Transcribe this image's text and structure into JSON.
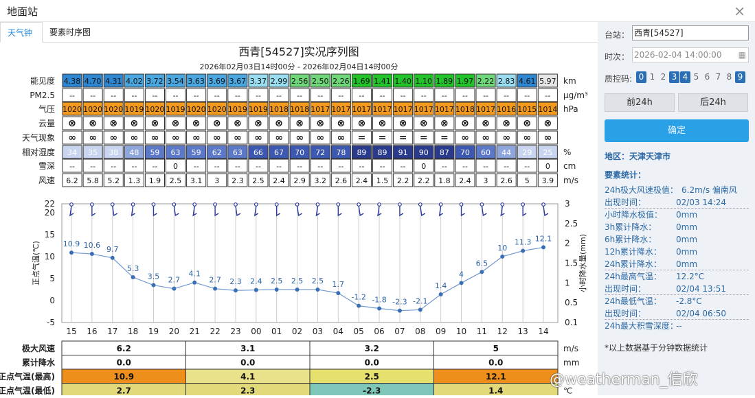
{
  "window": {
    "title": "地面站",
    "close": "×"
  },
  "tabs": [
    {
      "label": "天气钟",
      "active": true
    },
    {
      "label": "要素时序图",
      "active": false
    }
  ],
  "chart_title": "西青[54527]实况序列图",
  "time_range": "2026年02月03日14时00分 - 2026年02月04日14时00分",
  "rows": [
    {
      "label": "能见度",
      "unit": "km",
      "values": [
        "4.38",
        "4.70",
        "4.31",
        "4.02",
        "3.72",
        "3.54",
        "3.63",
        "3.69",
        "3.67",
        "3.37",
        "2.99",
        "2.56",
        "2.50",
        "2.26",
        "1.69",
        "1.41",
        "1.40",
        "1.10",
        "1.89",
        "1.97",
        "2.22",
        "2.83",
        "4.61",
        "5.97"
      ]
    },
    {
      "label": "PM2.5",
      "unit": "μg/m³",
      "values": [
        "--",
        "--",
        "--",
        "--",
        "--",
        "--",
        "--",
        "--",
        "--",
        "--",
        "--",
        "--",
        "--",
        "--",
        "--",
        "--",
        "--",
        "--",
        "--",
        "--",
        "--",
        "--",
        "--",
        "--"
      ]
    },
    {
      "label": "气压",
      "unit": "hPa",
      "values": [
        "1020",
        "1020",
        "1020",
        "1019",
        "1020",
        "1019",
        "1020",
        "1020",
        "1019",
        "1019",
        "1018",
        "1018",
        "1017",
        "1017",
        "1017",
        "1017",
        "1017",
        "1017",
        "1017",
        "1018",
        "1017",
        "1016",
        "1015",
        "1014"
      ]
    },
    {
      "label": "云量",
      "unit": "",
      "values": [
        "⊗",
        "⊗",
        "⊗",
        "⊗",
        "⊗",
        "⊗",
        "⊗",
        "⊗",
        "⊗",
        "⊗",
        "⊗",
        "⊗",
        "⊗",
        "⊗",
        "⊗",
        "⊗",
        "⊗",
        "⊗",
        "⊗",
        "⊗",
        "⊗",
        "⊗",
        "⊗",
        "⊗"
      ]
    },
    {
      "label": "天气现象",
      "unit": "",
      "values": [
        "∞",
        "∞",
        "∞",
        "∞",
        "∞",
        "∞",
        "∞",
        "∞",
        "∞",
        "∞",
        "∞",
        "∞",
        "∞",
        "∞",
        "=",
        "=",
        "=",
        "=",
        "=",
        "∞",
        "∞",
        "∞",
        "∞",
        "∞"
      ]
    },
    {
      "label": "相对湿度",
      "unit": "%",
      "values": [
        "34",
        "35",
        "38",
        "48",
        "59",
        "63",
        "59",
        "62",
        "63",
        "66",
        "67",
        "70",
        "72",
        "78",
        "89",
        "89",
        "91",
        "90",
        "87",
        "70",
        "60",
        "44",
        "29",
        "25"
      ]
    },
    {
      "label": "雪深",
      "unit": "cm",
      "values": [
        "--",
        "--",
        "--",
        "--",
        "--",
        "0",
        "--",
        "--",
        "--",
        "--",
        "--",
        "--",
        "--",
        "--",
        "--",
        "--",
        "--",
        "0",
        "--",
        "--",
        "--",
        "--",
        "--",
        "0"
      ]
    },
    {
      "label": "风速",
      "unit": "m/s",
      "values": [
        "6.2",
        "5.8",
        "5.2",
        "1.3",
        "1.9",
        "2.5",
        "3.1",
        "3",
        "2.3",
        "2.5",
        "2.4",
        "2.9",
        "3.2",
        "2.6",
        "2.4",
        "1.5",
        "2.2",
        "2.2",
        "1.8",
        "2.4",
        "3",
        "2.6",
        "5",
        "3.9"
      ]
    }
  ],
  "chart_data": {
    "type": "line",
    "x": [
      "15",
      "16",
      "17",
      "18",
      "19",
      "20",
      "21",
      "22",
      "23",
      "00",
      "01",
      "02",
      "03",
      "04",
      "05",
      "06",
      "07",
      "08",
      "09",
      "10",
      "11",
      "12",
      "13",
      "14"
    ],
    "series": [
      {
        "name": "正点气温(℃)",
        "values": [
          10.9,
          10.6,
          9.7,
          5.3,
          3.5,
          2.7,
          4.1,
          2.7,
          2.3,
          2.4,
          2.5,
          2.5,
          2.5,
          1.7,
          -1.2,
          -1.8,
          -2.3,
          -2.1,
          1.4,
          4,
          6.5,
          10,
          11.3,
          12.1
        ]
      }
    ],
    "ylabel": "正点气温(℃)",
    "y2label": "小时降水量(mm)",
    "yticks": [
      -5,
      0,
      5,
      10,
      15,
      20,
      22
    ],
    "ylim": [
      -5,
      22
    ],
    "y2ticks": [
      "0.1",
      "0.5",
      "1",
      "1.5",
      "2",
      "2.5",
      "3"
    ],
    "grid": true
  },
  "summary": {
    "rows": [
      {
        "label": "极大风速",
        "unit": "m/s",
        "values": [
          "6.2",
          "3.1",
          "3.2",
          "5"
        ]
      },
      {
        "label": "累计降水",
        "unit": "mm",
        "values": [
          "0.0",
          "0.0",
          "0.0",
          "0.0"
        ]
      },
      {
        "label": "正点气温(最高)",
        "unit": "",
        "values": [
          "10.9",
          "4.1",
          "2.5",
          "12.1"
        ]
      },
      {
        "label": "正点气温(最低)",
        "unit": "℃",
        "values": [
          "2.7",
          "2.3",
          "-2.3",
          "1.4"
        ]
      }
    ]
  },
  "side": {
    "station_label": "台站：",
    "station_value": "西青[54527]",
    "time_label": "时次：",
    "time_value": "2026-02-04 14:00:00",
    "qc_label": "质控码:",
    "qc": [
      {
        "n": "0",
        "on": true
      },
      {
        "n": "1",
        "on": false
      },
      {
        "n": "2",
        "on": false
      },
      {
        "n": "3",
        "on": true
      },
      {
        "n": "4",
        "on": true
      },
      {
        "n": "5",
        "on": false
      },
      {
        "n": "6",
        "on": false
      },
      {
        "n": "7",
        "on": false
      },
      {
        "n": "8",
        "on": false
      },
      {
        "n": "9",
        "on": true
      }
    ],
    "prev": "前24h",
    "next": "后24h",
    "confirm": "确定",
    "region": "地区：天津天津市",
    "stats_title": "要素统计：",
    "stats": [
      {
        "k": "24h极大风速极值：",
        "v": "6.2m/s 偏南风"
      },
      {
        "k": "出现时间：",
        "v": "02/03 14:24"
      },
      {
        "k": "小时降水极值：",
        "v": "0mm"
      },
      {
        "k": "3h累计降水：",
        "v": "0mm"
      },
      {
        "k": "6h累计降水：",
        "v": "0mm"
      },
      {
        "k": "12h累计降水：",
        "v": "0mm"
      },
      {
        "k": "24h累计降水：",
        "v": "0mm"
      },
      {
        "k": "24h最高气温：",
        "v": "12.2°C"
      },
      {
        "k": "出现时间：",
        "v": "02/04 13:51"
      },
      {
        "k": "24h最低气温：",
        "v": "-2.8°C"
      },
      {
        "k": "出现时间：",
        "v": "02/04 06:50"
      },
      {
        "k": "24h最大积雪深度：",
        "v": "--"
      }
    ],
    "note": "*以上数据基于分钟数据统计"
  },
  "watermark": "@weatherman_信欣"
}
